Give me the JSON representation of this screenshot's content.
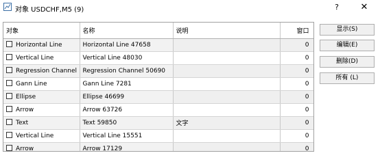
{
  "window": {
    "title": "对象 USDCHF,M5 (9)",
    "help_label": "?",
    "close_label": "✕"
  },
  "table": {
    "columns": [
      "对象",
      "名称",
      "说明",
      "窗口"
    ],
    "rows": [
      {
        "type": "Horizontal Line",
        "name": "Horizontal Line 47658",
        "desc": "",
        "window": "0"
      },
      {
        "type": "Vertical Line",
        "name": "Vertical Line 48030",
        "desc": "",
        "window": "0"
      },
      {
        "type": "Regression Channel",
        "name": "Regression Channel 50690",
        "desc": "",
        "window": "0"
      },
      {
        "type": "Gann Line",
        "name": "Gann Line 7281",
        "desc": "",
        "window": "0"
      },
      {
        "type": "Ellipse",
        "name": "Ellipse 46699",
        "desc": "",
        "window": "0"
      },
      {
        "type": "Arrow",
        "name": "Arrow 63726",
        "desc": "",
        "window": "0"
      },
      {
        "type": "Text",
        "name": "Text 59850",
        "desc": "文字",
        "window": "0"
      },
      {
        "type": "Vertical Line",
        "name": "Vertical Line 15551",
        "desc": "",
        "window": "0"
      },
      {
        "type": "Arrow",
        "name": "Arrow 17129",
        "desc": "",
        "window": "0"
      }
    ]
  },
  "buttons": {
    "show": "显示(S)",
    "edit": "编辑(E)",
    "delete": "删除(D)",
    "all": "所有 (L)"
  }
}
